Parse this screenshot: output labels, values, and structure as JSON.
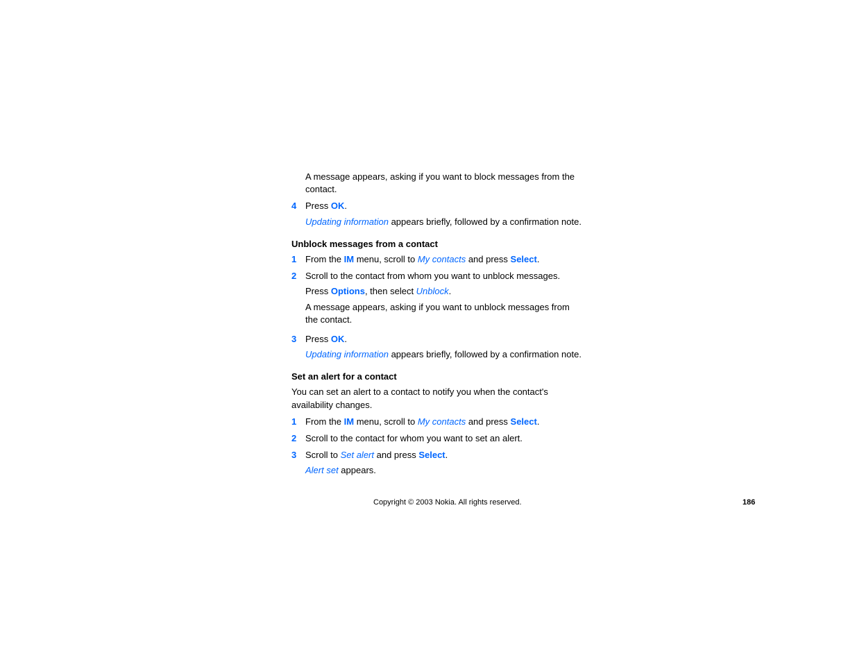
{
  "intro": {
    "line1": "A message appears, asking if you want to block messages from the contact."
  },
  "step4": {
    "num": "4",
    "prefix": "Press ",
    "ok": "OK",
    "suffix": ".",
    "note_em": "Updating information",
    "note_rest": " appears briefly, followed by a confirmation note."
  },
  "section_unblock": {
    "heading": "Unblock messages from a contact",
    "step1": {
      "num": "1",
      "t1": "From the ",
      "im": "IM",
      "t2": " menu, scroll to ",
      "mycontacts": "My contacts",
      "t3": " and press ",
      "select": "Select",
      "t4": "."
    },
    "step2": {
      "num": "2",
      "line1": "Scroll to the contact from whom you want to unblock messages.",
      "line2a": "Press ",
      "options": "Options",
      "line2b": ", then select ",
      "unblock": "Unblock",
      "line2c": ".",
      "line3": "A message appears, asking if you want to unblock messages from the contact."
    },
    "step3": {
      "num": "3",
      "t1": "Press ",
      "ok": "OK",
      "t2": ".",
      "note_em": "Updating information",
      "note_rest": " appears briefly, followed by a confirmation note."
    }
  },
  "section_alert": {
    "heading": "Set an alert for a contact",
    "intro": "You can set an alert to a contact to notify you when the contact's availability changes.",
    "step1": {
      "num": "1",
      "t1": "From the ",
      "im": "IM",
      "t2": " menu, scroll to ",
      "mycontacts": "My contacts",
      "t3": " and press ",
      "select": "Select",
      "t4": "."
    },
    "step2": {
      "num": "2",
      "text": "Scroll to the contact for whom you want to set an alert."
    },
    "step3": {
      "num": "3",
      "t1": "Scroll to ",
      "setalert": "Set alert",
      "t2": " and press ",
      "select": "Select",
      "t3": ".",
      "note_em": "Alert set",
      "note_rest": " appears."
    }
  },
  "footer": {
    "copyright": "Copyright © 2003 Nokia. All rights reserved.",
    "page": "186"
  }
}
